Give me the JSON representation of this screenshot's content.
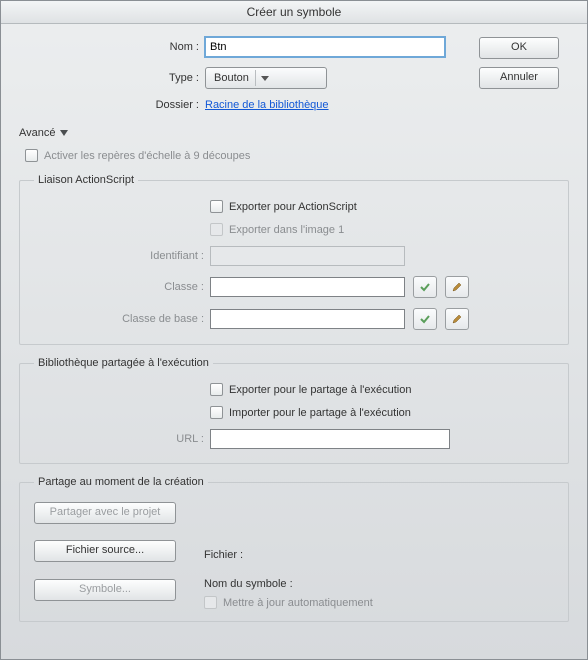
{
  "window": {
    "title": "Créer un symbole"
  },
  "buttons": {
    "ok": "OK",
    "cancel": "Annuler"
  },
  "fields": {
    "name_label": "Nom :",
    "name_value": "Btn",
    "type_label": "Type :",
    "type_value": "Bouton",
    "folder_label": "Dossier :",
    "folder_value": "Racine de la bibliothèque"
  },
  "advanced": {
    "label": "Avancé"
  },
  "scale9": {
    "label": "Activer les repères d'échelle à 9 découpes"
  },
  "as": {
    "legend": "Liaison ActionScript",
    "export_as": "Exporter pour ActionScript",
    "export_frame1": "Exporter dans l'image 1",
    "id_label": "Identifiant :",
    "class_label": "Classe :",
    "baseclass_label": "Classe de base :",
    "class_value": "",
    "baseclass_value": ""
  },
  "rts": {
    "legend": "Bibliothèque partagée à l'exécution",
    "export": "Exporter pour le partage à l'exécution",
    "import": "Importer pour le partage à l'exécution",
    "url_label": "URL :",
    "url_value": ""
  },
  "ats": {
    "legend": "Partage au moment de la création",
    "share_project": "Partager avec le projet",
    "source_file": "Fichier source...",
    "symbol": "Symbole...",
    "file_label": "Fichier :",
    "symbol_name_label": "Nom du symbole :",
    "auto_update": "Mettre à jour automatiquement"
  },
  "icons": {
    "check": "check-icon",
    "pencil": "pencil-icon",
    "chevron": "chevron-down-icon"
  }
}
